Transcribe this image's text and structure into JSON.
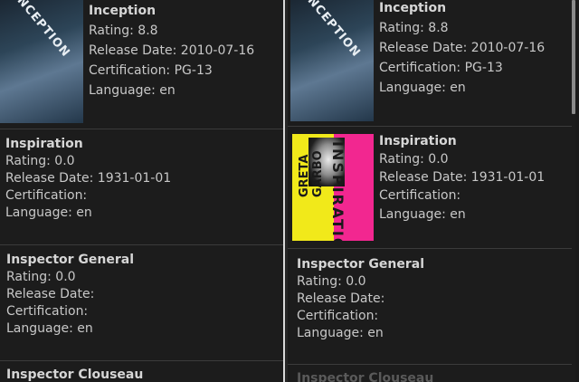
{
  "labels": {
    "rating": "Rating: ",
    "release": "Release Date: ",
    "cert": "Certification: ",
    "language": "Language: "
  },
  "left": {
    "movies": [
      {
        "title": "Inception",
        "rating": "Rating: 8.8",
        "release": "Release Date: 2010-07-16",
        "cert": "Certification: PG-13",
        "language": "Language: en"
      },
      {
        "title": "Inspiration",
        "rating": "Rating: 0.0",
        "release": "Release Date: 1931-01-01",
        "cert": "Certification:",
        "language": "Language: en"
      },
      {
        "title": "Inspector General",
        "rating": "Rating: 0.0",
        "release": "Release Date:",
        "cert": "Certification:",
        "language": "Language: en"
      },
      {
        "title": "Inspector Clouseau"
      }
    ]
  },
  "right": {
    "movies": [
      {
        "title": "Inception",
        "rating": "Rating: 8.8",
        "release": "Release Date: 2010-07-16",
        "cert": "Certification: PG-13",
        "language": "Language: en"
      },
      {
        "title": "Inspiration",
        "rating": "Rating: 0.0",
        "release": "Release Date: 1931-01-01",
        "cert": "Certification:",
        "language": "Language: en"
      },
      {
        "title": "Inspector General",
        "rating": "Rating: 0.0",
        "release": "Release Date:",
        "cert": "Certification:",
        "language": "Language: en"
      },
      {
        "title": "Inspector Clouseau"
      }
    ]
  },
  "posters": {
    "inception_title": "INCEPTION",
    "inspiration_title": "INSPIRATION",
    "inspiration_star": "GRETA GARBO"
  }
}
